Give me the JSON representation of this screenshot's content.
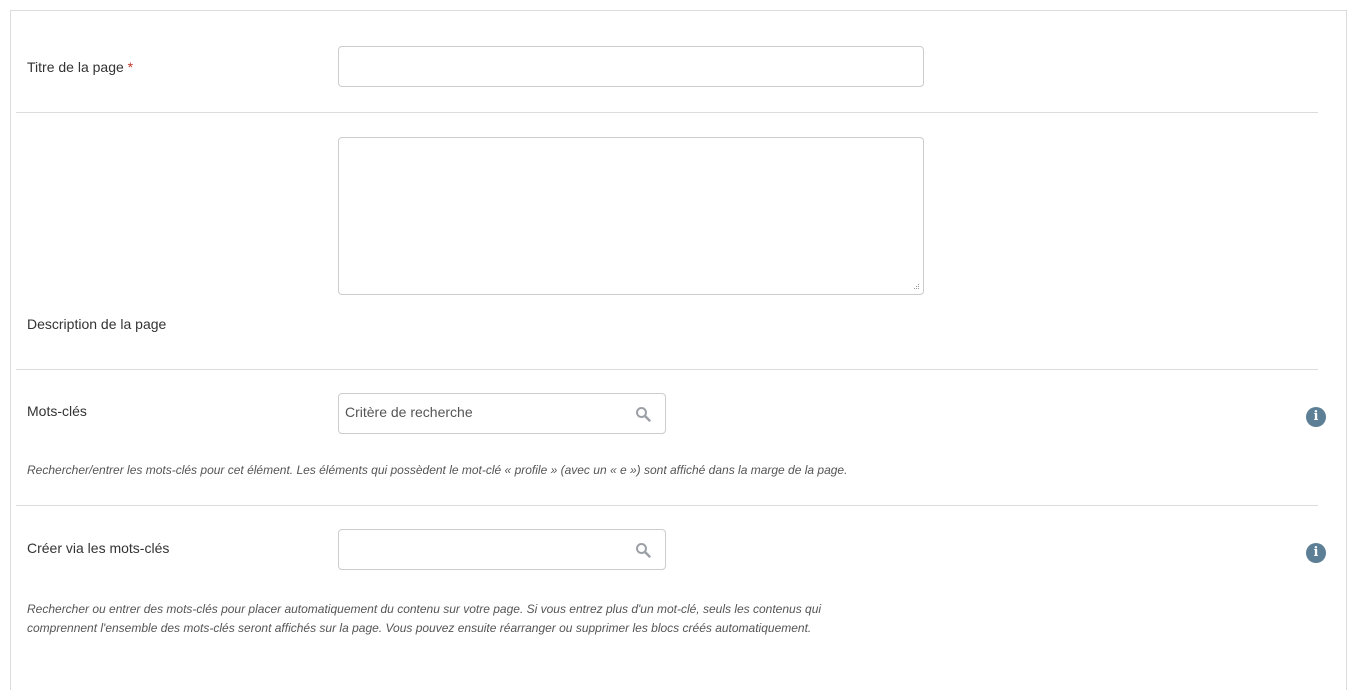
{
  "fields": {
    "title": {
      "label": "Titre de la page",
      "required_marker": "*",
      "value": ""
    },
    "description": {
      "label": "Description de la page",
      "value": ""
    },
    "tags": {
      "label": "Mots-clés",
      "placeholder": "Critère de recherche",
      "help_icon": "info-icon",
      "help_text": "Rechercher/entrer les mots-clés pour cet élément. Les éléments qui possèdent le mot-clé « profile » (avec un « e ») sont affiché dans la marge de la page."
    },
    "create_via_tags": {
      "label": "Créer via les mots-clés",
      "placeholder": "",
      "help_icon": "info-icon",
      "help_text_line1": "Rechercher ou entrer des mots-clés pour placer automatiquement du contenu sur votre page. Si vous entrez plus d'un mot-clé, seuls les contenus qui",
      "help_text_line2": "comprennent l'ensemble des mots-clés seront affichés sur la page. Vous pouvez ensuite réarranger ou supprimer les blocs créés automatiquement."
    }
  },
  "colors": {
    "required": "#c0392b",
    "info_icon": "#5d7f95",
    "border": "#cccccc",
    "divider": "#dcdcdc"
  }
}
